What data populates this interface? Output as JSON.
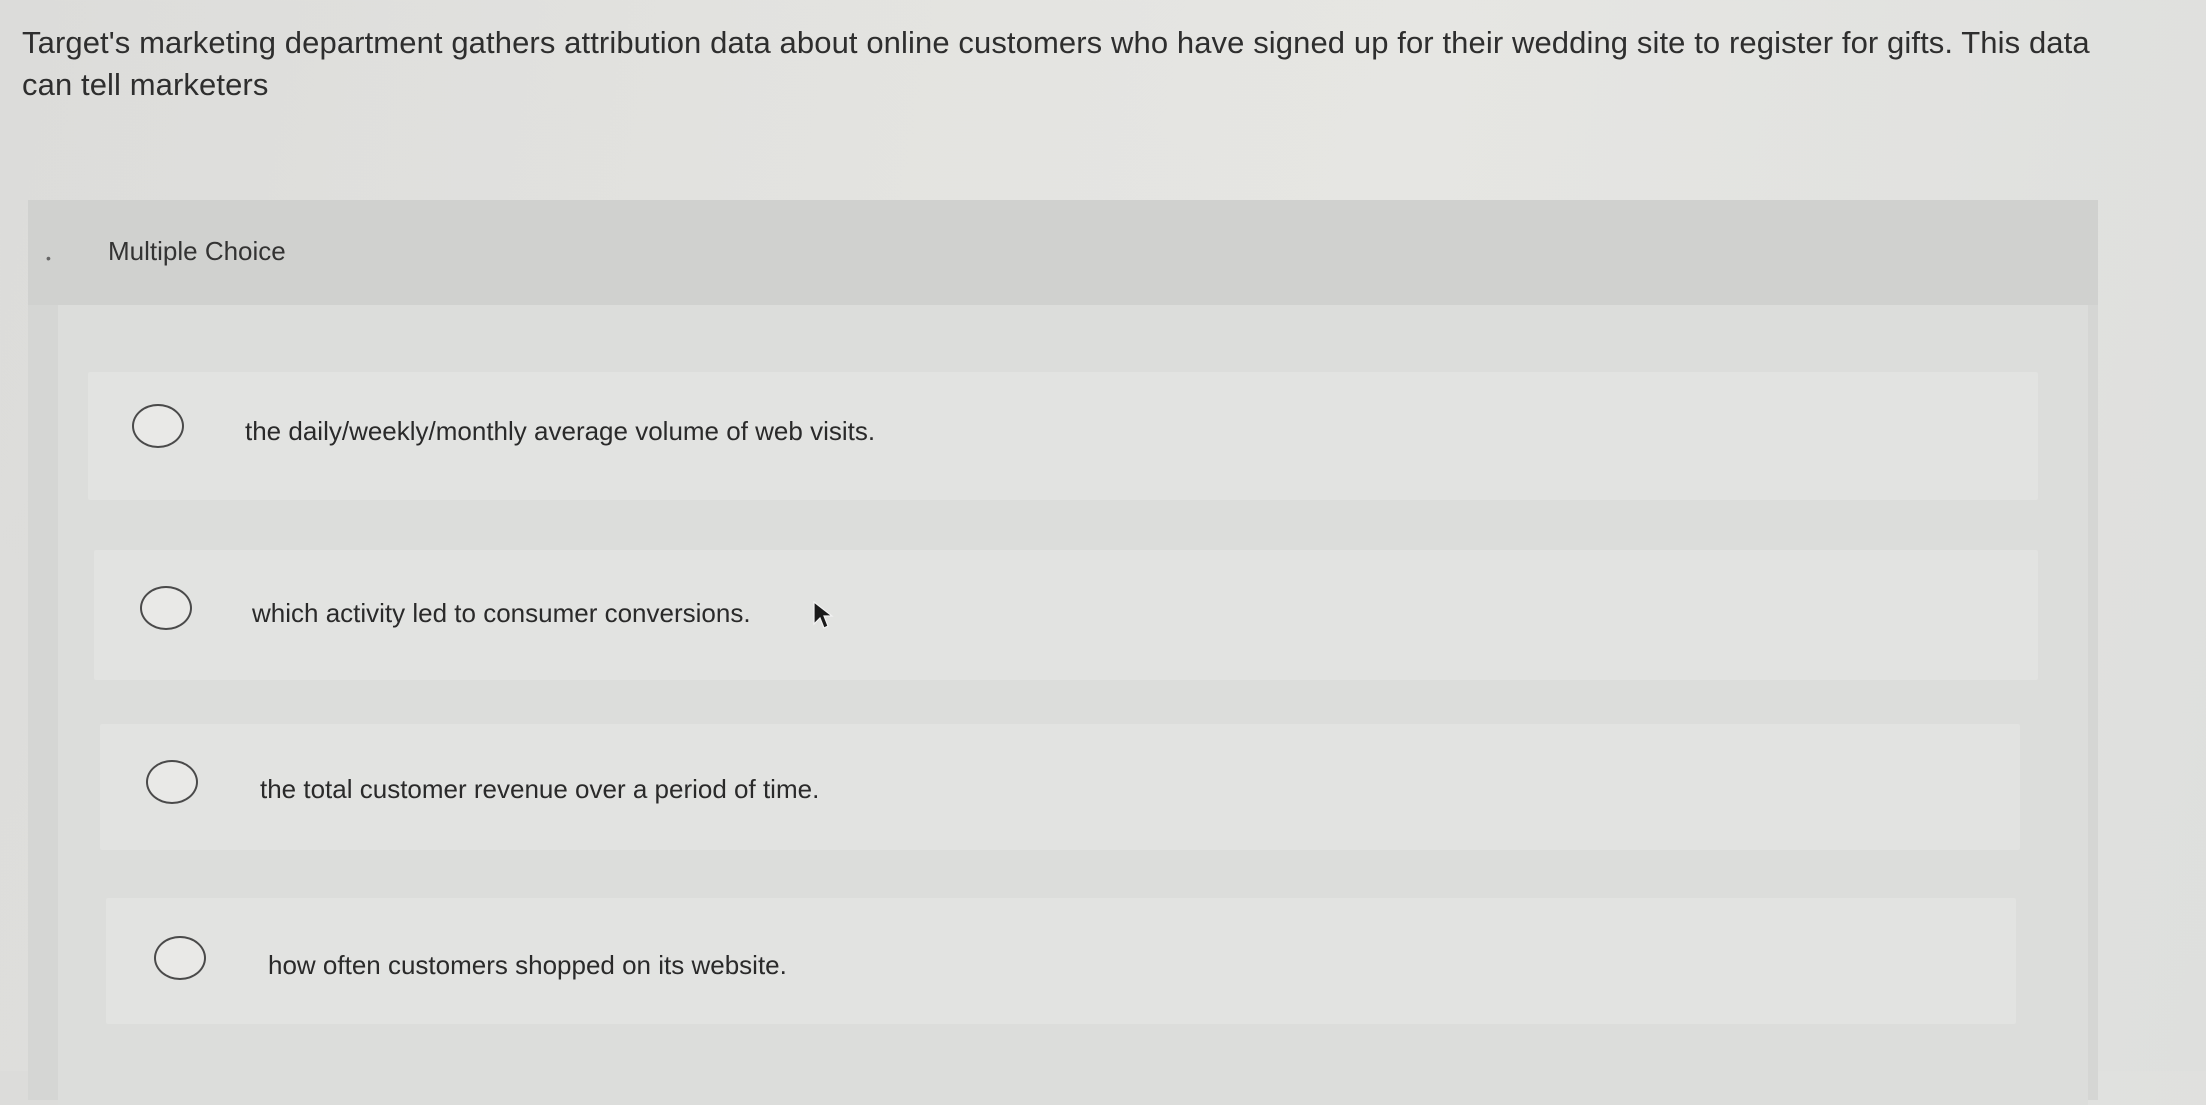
{
  "question": {
    "text": "Target's marketing department gathers attribution data about online customers who have signed up for their wedding site to register for gifts. This data can tell marketers"
  },
  "panel": {
    "header_label": "Multiple Choice"
  },
  "options": [
    {
      "label": "the daily/weekly/monthly average volume of web visits."
    },
    {
      "label": "which activity led to consumer conversions."
    },
    {
      "label": "the total customer revenue over a period of time."
    },
    {
      "label": "how often customers shopped on its website."
    }
  ],
  "icons": {
    "radio": "radio-button-icon",
    "cursor": "mouse-pointer-icon"
  }
}
